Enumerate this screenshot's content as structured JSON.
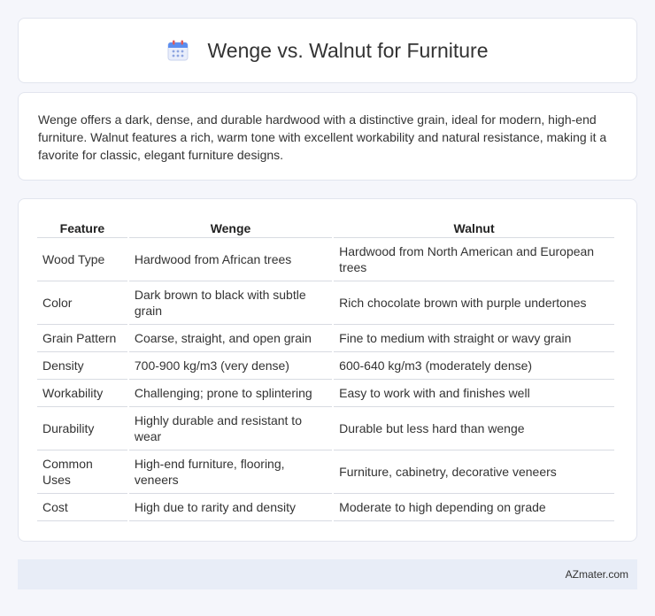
{
  "header": {
    "title": "Wenge vs. Walnut for Furniture",
    "icon": "calendar-icon"
  },
  "intro": {
    "text": "Wenge offers a dark, dense, and durable hardwood with a distinctive grain, ideal for modern, high-end furniture. Walnut features a rich, warm tone with excellent workability and natural resistance, making it a favorite for classic, elegant furniture designs."
  },
  "table": {
    "headers": [
      "Feature",
      "Wenge",
      "Walnut"
    ],
    "rows": [
      [
        "Wood Type",
        "Hardwood from African trees",
        "Hardwood from North American and European trees"
      ],
      [
        "Color",
        "Dark brown to black with subtle grain",
        "Rich chocolate brown with purple undertones"
      ],
      [
        "Grain Pattern",
        "Coarse, straight, and open grain",
        "Fine to medium with straight or wavy grain"
      ],
      [
        "Density",
        "700-900 kg/m3 (very dense)",
        "600-640 kg/m3 (moderately dense)"
      ],
      [
        "Workability",
        "Challenging; prone to splintering",
        "Easy to work with and finishes well"
      ],
      [
        "Durability",
        "Highly durable and resistant to wear",
        "Durable but less hard than wenge"
      ],
      [
        "Common Uses",
        "High-end furniture, flooring, veneers",
        "Furniture, cabinetry, decorative veneers"
      ],
      [
        "Cost",
        "High due to rarity and density",
        "Moderate to high depending on grade"
      ]
    ]
  },
  "footer": {
    "brand": "AZmater.com"
  },
  "colors": {
    "accent_blue": "#5b8def",
    "accent_red": "#e05a5a"
  }
}
